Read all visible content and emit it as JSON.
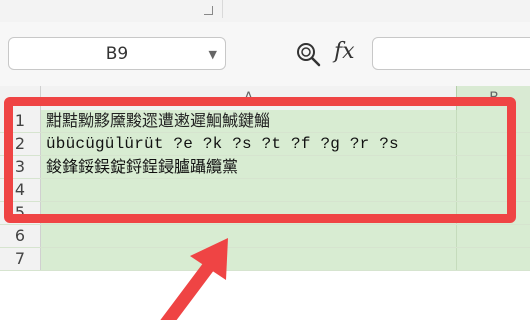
{
  "formula_bar": {
    "name_box_value": "B9",
    "zoom_icon": "cell-zoom-icon",
    "fx_label": "fx",
    "formula_value": ""
  },
  "columns": {
    "a_label": "A",
    "b_label": "B"
  },
  "rows": [
    {
      "num": "1",
      "a": "黚黠黝黟黡黢遝遭遫遲鮰鯎鍵鯔"
    },
    {
      "num": "2",
      "a": "übücügülürüt ?e ?k ?s ?t ?f ?g ?r ?s"
    },
    {
      "num": "3",
      "a": "鋑鋒鋖鋘錠鋝鋥鋟臚躡纜黨"
    },
    {
      "num": "4",
      "a": ""
    },
    {
      "num": "5",
      "a": ""
    },
    {
      "num": "6",
      "a": ""
    },
    {
      "num": "7",
      "a": ""
    }
  ],
  "colors": {
    "highlight": "#ef4444",
    "selection_fill": "#d8ecd2"
  }
}
